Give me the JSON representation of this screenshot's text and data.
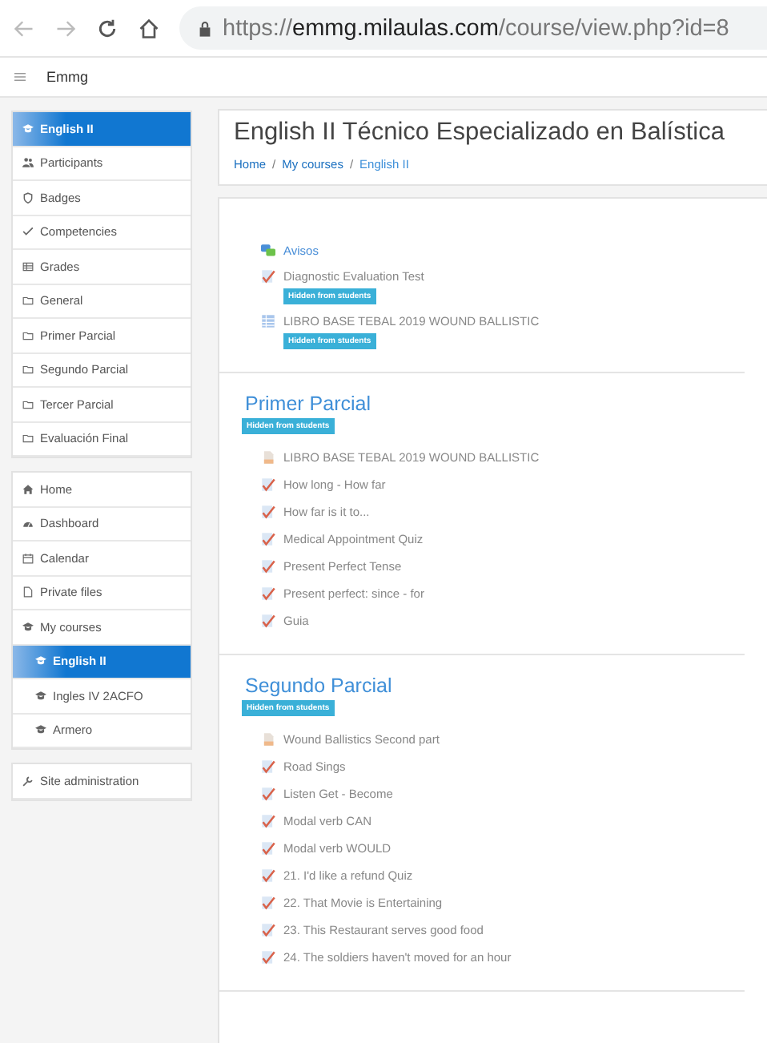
{
  "browser": {
    "url": "https://**emmg.milaulas.com**/course/view.php?id=8",
    "back_disabled": true,
    "forward_disabled": true
  },
  "navbar": {
    "site_name": "Emmg"
  },
  "sidebar": {
    "groups": [
      {
        "items": [
          {
            "label": "English II",
            "kind": "cap",
            "selected": true
          },
          {
            "label": "Participants",
            "kind": "users",
            "selected": false
          },
          {
            "label": "Badges",
            "kind": "shield",
            "selected": false
          },
          {
            "label": "Competencies",
            "kind": "check",
            "selected": false
          },
          {
            "label": "Grades",
            "kind": "table",
            "selected": false
          },
          {
            "label": "General",
            "kind": "folder",
            "selected": false
          },
          {
            "label": "Primer Parcial",
            "kind": "folder",
            "selected": false
          },
          {
            "label": "Segundo Parcial",
            "kind": "folder",
            "selected": false
          },
          {
            "label": "Tercer Parcial",
            "kind": "folder",
            "selected": false
          },
          {
            "label": "Evaluación Final",
            "kind": "folder",
            "selected": false
          }
        ]
      },
      {
        "items": [
          {
            "label": "Home",
            "kind": "home",
            "selected": false
          },
          {
            "label": "Dashboard",
            "kind": "dashboard",
            "selected": false
          },
          {
            "label": "Calendar",
            "kind": "calendar",
            "selected": false
          },
          {
            "label": "Private files",
            "kind": "file",
            "selected": false
          },
          {
            "label": "My courses",
            "kind": "cap",
            "selected": false,
            "children": [
              {
                "label": "English II",
                "kind": "cap",
                "selected": true
              },
              {
                "label": "Ingles IV 2ACFO",
                "kind": "cap",
                "selected": false
              },
              {
                "label": "Armero",
                "kind": "cap",
                "selected": false
              }
            ]
          }
        ]
      },
      {
        "items": [
          {
            "label": "Site administration",
            "kind": "wrench",
            "selected": false
          }
        ]
      }
    ]
  },
  "course": {
    "title": "English II Técnico Especializado en Balística",
    "breadcrumb": [
      {
        "label": "Home",
        "separator": "/"
      },
      {
        "label": "My courses",
        "separator": "/"
      },
      {
        "label": "English II"
      }
    ],
    "sections": [
      {
        "activities": [
          {
            "name": "Avisos",
            "kind": "forum"
          },
          {
            "name": "Diagnostic Evaluation Test",
            "kind": "quiz",
            "badge": "Hidden from students"
          },
          {
            "name": "LIBRO BASE TEBAL 2019 WOUND BALLISTIC",
            "kind": "book",
            "badge": "Hidden from students"
          }
        ]
      },
      {
        "title": "Primer Parcial",
        "badge": "Hidden from students",
        "activities": [
          {
            "name": "LIBRO BASE TEBAL 2019 WOUND BALLISTIC",
            "kind": "file"
          },
          {
            "name": "How long - How far",
            "kind": "quiz"
          },
          {
            "name": "How far is it to...",
            "kind": "quiz"
          },
          {
            "name": "Medical Appointment Quiz",
            "kind": "quiz"
          },
          {
            "name": "Present Perfect Tense",
            "kind": "quiz"
          },
          {
            "name": "Present perfect: since - for",
            "kind": "quiz"
          },
          {
            "name": "Guia",
            "kind": "quiz"
          }
        ]
      },
      {
        "title": "Segundo Parcial",
        "badge": "Hidden from students",
        "activities": [
          {
            "name": "Wound Ballistics Second part",
            "kind": "file"
          },
          {
            "name": "Road Sings",
            "kind": "quiz"
          },
          {
            "name": "Listen Get - Become",
            "kind": "quiz"
          },
          {
            "name": "Modal verb CAN",
            "kind": "quiz"
          },
          {
            "name": "Modal verb WOULD",
            "kind": "quiz"
          },
          {
            "name": "21. I'd like a refund Quiz",
            "kind": "quiz"
          },
          {
            "name": "22. That Movie is Entertaining",
            "kind": "quiz"
          },
          {
            "name": "23. This Restaurant serves good food",
            "kind": "quiz"
          },
          {
            "name": "24. The soldiers haven't moved for an hour",
            "kind": "quiz"
          }
        ]
      }
    ]
  }
}
